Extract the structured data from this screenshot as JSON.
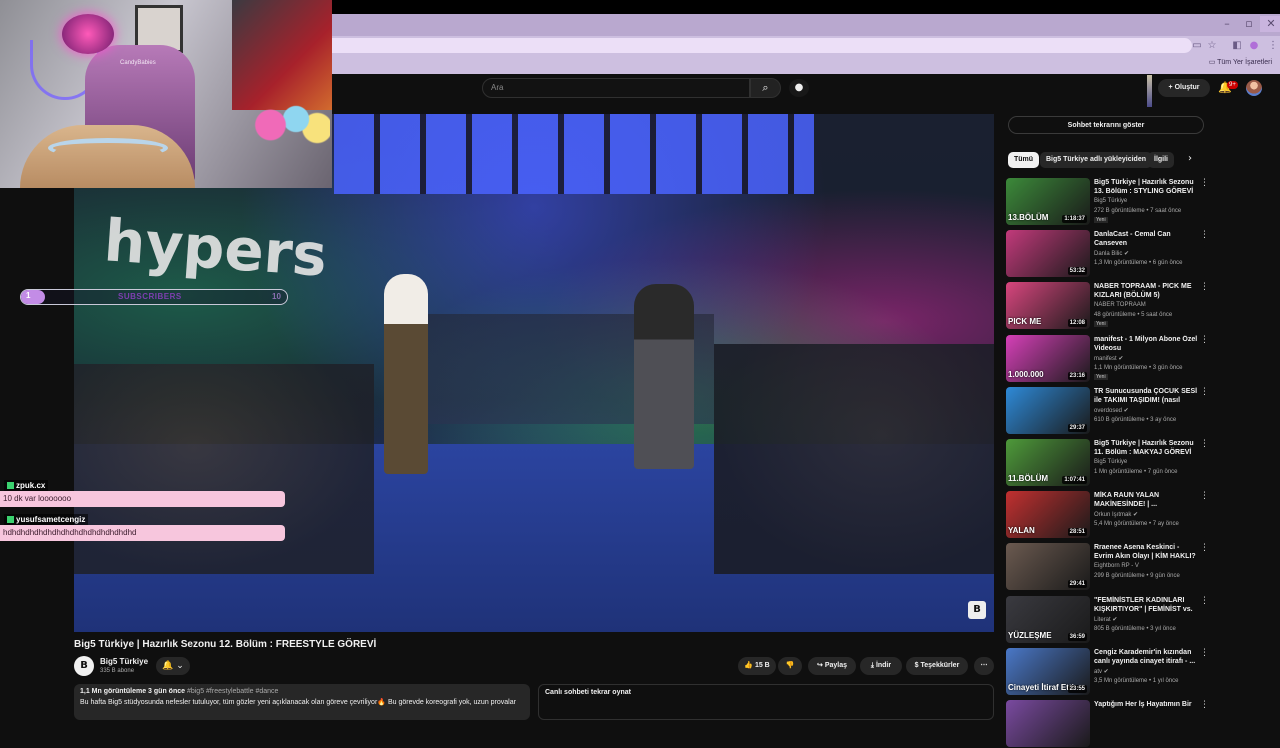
{
  "browser": {
    "window_controls": [
      "–",
      "▫",
      "✕"
    ],
    "bookmarks_label": "Tüm Yer İşaretleri",
    "omnibox_icons": [
      "cast-icon",
      "star-icon",
      "extension-icon",
      "profile-icon",
      "menu-icon"
    ]
  },
  "youtube_header": {
    "search_placeholder": "Ara",
    "search_icon": "⌕",
    "mic_icon": "🎙",
    "create_label": "+ Oluştur",
    "notifications_badge": "9+",
    "bell_icon": "🔔"
  },
  "webcam": {
    "name": "CandyBabies"
  },
  "overlay": {
    "subs_current": "1",
    "subs_label": "SUBSCRIBERS",
    "subs_goal": "10",
    "chat": [
      {
        "user": "zpuk.cx",
        "message": "10 dk var looooooo"
      },
      {
        "user": "yusufsametcengiz",
        "message": "hdhdhdhdhdhdhdhdhdhdhdhdhdhdhd"
      }
    ]
  },
  "video": {
    "scene_text": "hypers",
    "title": "Big5 Türkiye | Hazırlık Sezonu 12. Bölüm : FREESTYLE GÖREVİ",
    "channel": "Big5 Türkiye",
    "channel_initial": "B",
    "subscribers": "335 B abone",
    "likes": "15 B",
    "share": "Paylaş",
    "download": "İndir",
    "thanks": "Teşekkürler",
    "more": "⋯",
    "description_meta": "1,1 Mn görüntüleme  3 gün önce",
    "description_tags": "#big5 #freestylebattle #dance",
    "description_text": "Bu hafta Big5 stüdyosunda nefesler tutuluyor, tüm gözler yeni açıklanacak olan göreve çevriliyor🔥 Bu görevde koreografi yok, uzun provalar",
    "chat_replay": "Canlı sohbeti tekrar oynat"
  },
  "sidebar": {
    "show_chat": "Sohbet tekrarını göster",
    "chips": [
      "Tümü",
      "Big5 Türkiye adlı yükleyiciden",
      "İlgili"
    ],
    "recommendations": [
      {
        "title": "Big5 Türkiye | Hazırlık Sezonu 13. Bölüm : STYLING GÖREVİ",
        "channel": "Big5 Türkiye",
        "meta": "272 B görüntüleme • 7 saat önce",
        "badge": "Yeni",
        "duration": "1:18:37",
        "thumb_text": "13.BÖLÜM",
        "thumb_color": "#3c8a3a"
      },
      {
        "title": "DanlaCast - Cemal Can Canseven",
        "channel": "Danla Bilic ✔",
        "meta": "1,3 Mn görüntüleme • 6 gün önce",
        "badge": "",
        "duration": "53:32",
        "thumb_text": "",
        "thumb_color": "#c23a7b"
      },
      {
        "title": "NABER TOPRAAM - PICK ME KIZLARI (BÖLÜM 5)",
        "channel": "NABER TOPRAAM",
        "meta": "48 görüntüleme • 5 saat önce",
        "badge": "Yeni",
        "duration": "12:08",
        "thumb_text": "PICK ME",
        "thumb_color": "#d8467e"
      },
      {
        "title": "manifest - 1 Milyon Abone Özel Videosu",
        "channel": "manifest ✔",
        "meta": "1,1 Mn görüntüleme • 3 gün önce",
        "badge": "Yeni",
        "duration": "23:16",
        "thumb_text": "1.000.000",
        "thumb_color": "#d640b8"
      },
      {
        "title": "TR Sunucusunda ÇOCUK SESİ ile TAKIMI TAŞIDIM! (nasıl tep...",
        "channel": "overdosed ✔",
        "meta": "610 B görüntüleme • 3 ay önce",
        "badge": "",
        "duration": "29:37",
        "thumb_text": "",
        "thumb_color": "#2e8ad8"
      },
      {
        "title": "Big5 Türkiye | Hazırlık Sezonu 11. Bölüm : MAKYAJ GÖREVİ",
        "channel": "Big5 Türkiye",
        "meta": "1 Mn görüntüleme • 7 gün önce",
        "badge": "",
        "duration": "1:07:41",
        "thumb_text": "11.BÖLÜM",
        "thumb_color": "#4e9a3a"
      },
      {
        "title": "MİKA RAUN YALAN MAKİNESİNDE! | ...",
        "channel": "Orkun Işıtmak ✔",
        "meta": "5,4 Mn görüntüleme • 7 ay önce",
        "badge": "",
        "duration": "28:51",
        "thumb_text": "YALAN",
        "thumb_color": "#c23030"
      },
      {
        "title": "Rraenee Asena Keskinci - Evrim Akın Olayı | KİM HAKLI? İzliyor",
        "channel": "Eightborn RP - V",
        "meta": "299 B görüntüleme • 9 gün önce",
        "badge": "",
        "duration": "29:41",
        "thumb_text": "",
        "thumb_color": "#6b5a50"
      },
      {
        "title": "\"FEMİNİSTLER KADINLARI KIŞKIRTIYOR\" | FEMİNİST vs. ...",
        "channel": "Literat ✔",
        "meta": "805 B görüntüleme • 3 yıl önce",
        "badge": "",
        "duration": "36:59",
        "thumb_text": "YÜZLEŞME",
        "thumb_color": "#3a3a40"
      },
      {
        "title": "Cengiz Karademir'in kızından canlı yayında cinayet itirafı - ...",
        "channel": "atv ✔",
        "meta": "3,5 Mn görüntüleme • 1 yıl önce",
        "badge": "",
        "duration": "23:55",
        "thumb_text": "Cinayeti İtiraf Etti",
        "thumb_color": "#4a78c8"
      },
      {
        "title": "Yaptığım Her İş Hayatımın Bir",
        "channel": "",
        "meta": "",
        "badge": "",
        "duration": "",
        "thumb_text": "",
        "thumb_color": "#7a4aa0"
      }
    ]
  }
}
